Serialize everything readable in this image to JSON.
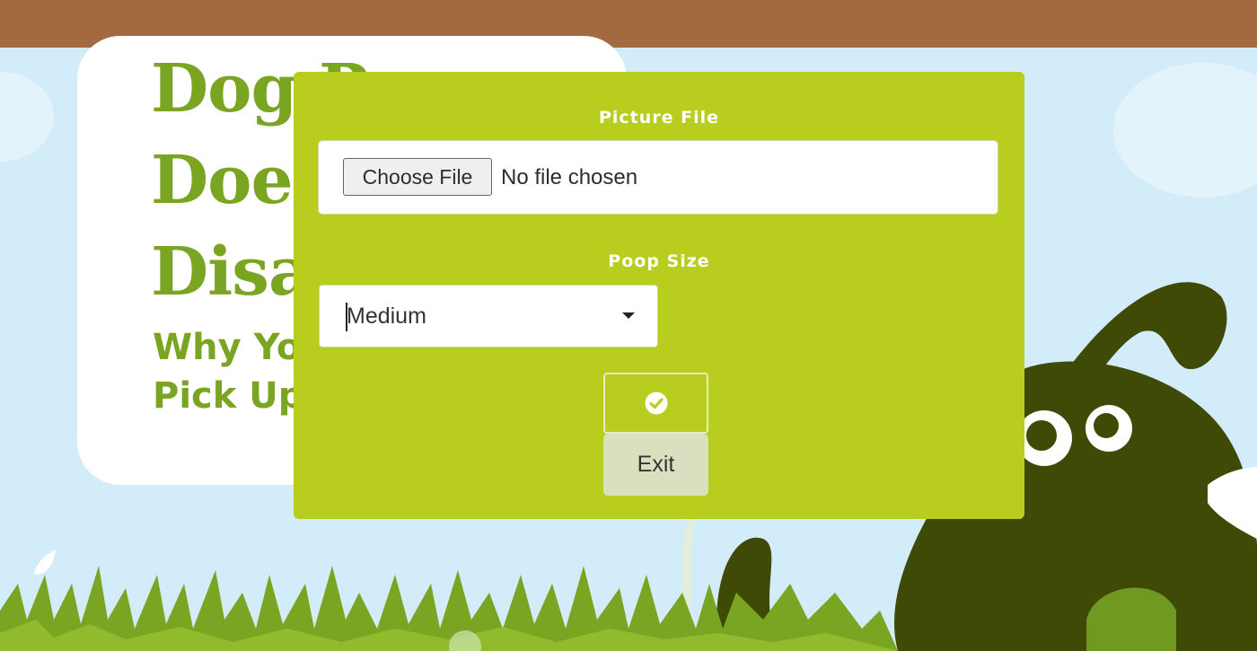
{
  "background": {
    "hero_title_lines": [
      "Dog Poop",
      "Doe",
      "Disa"
    ],
    "hero_sub_lines": [
      "Why Yo",
      "Pick Up"
    ]
  },
  "modal": {
    "picture_file_label": "Picture File",
    "choose_file_label": "Choose File",
    "no_file_text": "No file chosen",
    "poop_size_label": "Poop Size",
    "poop_size_value": "Medium",
    "confirm_icon": "check-circle-icon",
    "exit_label": "Exit"
  },
  "colors": {
    "header_brown": "#a46a3f",
    "sky": "#d3ecfa",
    "modal_green": "#b8cd1e",
    "title_green": "#7aa523",
    "grass_green": "#6f9a1f",
    "dog_dark": "#3e4a05"
  }
}
